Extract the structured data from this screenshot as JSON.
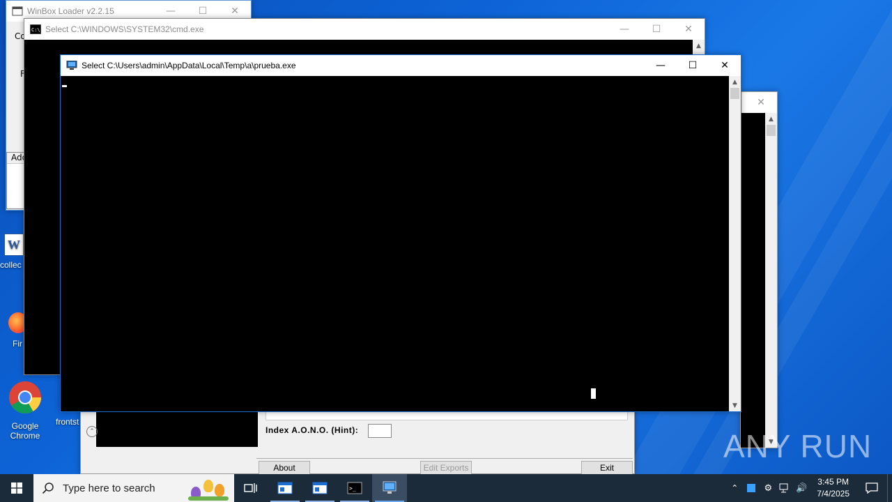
{
  "desktop": {
    "icons": [
      {
        "label": "Google Chrome"
      },
      {
        "label": "frontst"
      },
      {
        "label": "Fir"
      },
      {
        "label": "collec"
      }
    ],
    "watermark": "ANY RUN"
  },
  "winbox": {
    "title": "WinBox Loader v2.2.15",
    "partial_labels": [
      "Co",
      "F",
      "Add",
      "A"
    ]
  },
  "cmd": {
    "title": "Select C:\\WINDOWS\\SYSTEM32\\cmd.exe"
  },
  "prueba": {
    "title": "Select C:\\Users\\admin\\AppData\\Local\\Temp\\a\\prueba.exe"
  },
  "dialog": {
    "index_label": "Index A.O.N.O. (Hint):",
    "about_label": "About",
    "edit_exports_label": "Edit Exports",
    "exit_label": "Exit"
  },
  "taskbar": {
    "search_placeholder": "Type here to search",
    "time": "3:45 PM",
    "date": "7/4/2025"
  },
  "colors": {
    "accent": "#0078d7",
    "console_bg": "#000000",
    "taskbar_bg": "#1c2b3a"
  }
}
